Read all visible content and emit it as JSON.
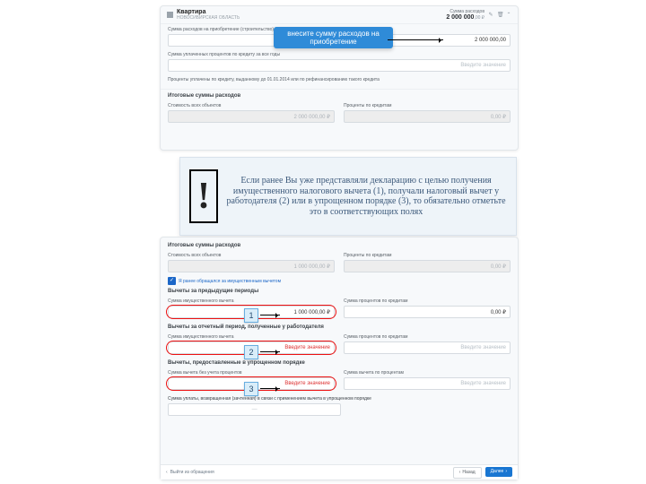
{
  "header": {
    "title": "Квартира",
    "subtitle": "НОВОСИБИРСКАЯ ОБЛАСТЬ",
    "sum_label": "Сумма расходов",
    "amount": "2 000 000",
    "cur": ",00 ₽"
  },
  "top": {
    "f1_label": "Сумма расходов на приобретение (строительство)",
    "f1_value": "2 000 000,00",
    "f2_label": "Сумма уплаченных процентов по кредиту за все годы",
    "f2_place": "Введите значение",
    "f3_label": "Проценты уплачены по кредиту, выданному до 01.01.2014 или по рефинансированию такого кредита",
    "totals_title": "Итоговые суммы расходов",
    "c1_label": "Стоимость всех объектов",
    "c1_val": "2 000 000,00 ₽",
    "c2_label": "Проценты по кредитам",
    "c2_val": "0,00 ₽"
  },
  "callout": "внесите сумму расходов на приобретение",
  "info": "Если ранее Вы уже представляли декларацию с целью получения имущественного налогового вычета (1), получали налоговый вычет у работодателя (2) или в упрощенном порядке (3), то обязательно отметьте это в соответствующих полях",
  "bot": {
    "totals_title": "Итоговые суммы расходов",
    "c1_label": "Стоимость всех объектов",
    "c1_val": "1 000 000,00 ₽",
    "c2_label": "Проценты по кредитам",
    "c2_val": "0,00 ₽",
    "chk_label": "Я ранее обращался за имущественным вычетом",
    "g1": "Вычеты за предыдущие периоды",
    "g1a_label": "Сумма имущественного вычета",
    "g1a_val": "1 000 000,00 ₽",
    "g1b_label": "Сумма процентов по кредитам",
    "g1b_val": "0,00 ₽",
    "g2": "Вычеты за отчетный период, полученные у работодателя",
    "g2a_label": "Сумма имущественного вычета",
    "g2b_label": "Сумма процентов по кредитам",
    "g3": "Вычеты, предоставленные в упрощенном порядке",
    "g3a_label": "Сумма вычета без учета процентов",
    "g3b_label": "Сумма вычета по процентам",
    "g4": "Сумма уплаты, возвращенная (зачтенная) в связи с применением вычета в упрощенном порядке",
    "place": "Введите значение",
    "dash": "—"
  },
  "tags": {
    "t1": "1",
    "t2": "2",
    "t3": "3"
  },
  "footer": {
    "exit": "Выйти из обращения",
    "back": "Назад",
    "next": "Далее"
  }
}
